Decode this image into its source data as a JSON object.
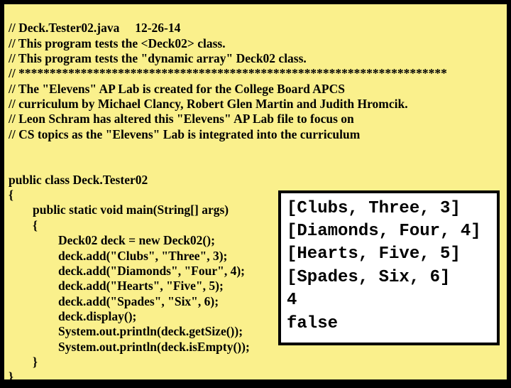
{
  "code": {
    "l01": "// Deck.Tester02.java     12-26-14",
    "l02": "// This program tests the <Deck02> class.",
    "l03": "// This program tests the \"dynamic array\" Deck02 class.",
    "l04": "// *********************************************************************",
    "l05": "// The \"Elevens\" AP Lab is created for the College Board APCS",
    "l06": "// curriculum by Michael Clancy, Robert Glen Martin and Judith Hromcik.",
    "l07": "// Leon Schram has altered this \"Elevens\" AP Lab file to focus on",
    "l08": "// CS topics as the \"Elevens\" Lab is integrated into the curriculum",
    "l09": "public class Deck.Tester02",
    "l10": "{",
    "l11": "public static void main(String[] args)",
    "l12": "{",
    "l13": "Deck02 deck = new Deck02();",
    "l14": "deck.add(\"Clubs\", \"Three\", 3);",
    "l15": "deck.add(\"Diamonds\", \"Four\", 4);",
    "l16": "deck.add(\"Hearts\", \"Five\", 5);",
    "l17": "deck.add(\"Spades\", \"Six\", 6);",
    "l18": "deck.display();",
    "l19": "System.out.println(deck.getSize());",
    "l20": "System.out.println(deck.isEmpty());",
    "l21": "}",
    "l22": "}"
  },
  "output": {
    "o1": "[Clubs, Three, 3]",
    "o2": "[Diamonds, Four, 4]",
    "o3": "[Hearts, Five, 5]",
    "o4": "[Spades, Six, 6]",
    "o5": "4",
    "o6": "false"
  }
}
